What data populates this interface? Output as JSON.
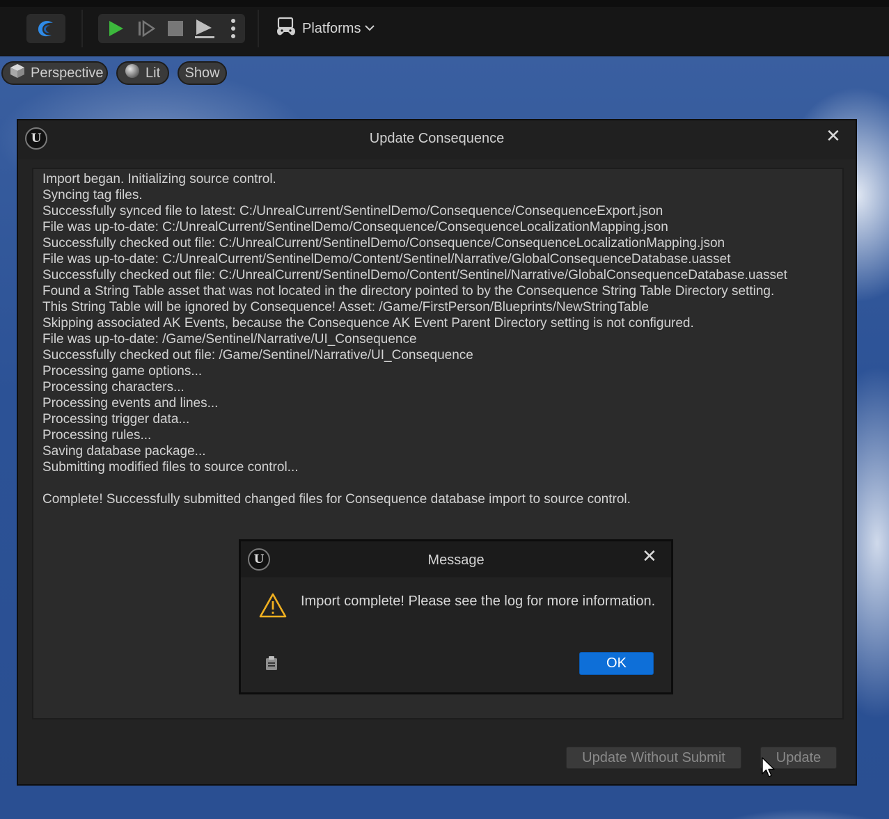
{
  "toolbar": {
    "platforms_label": "Platforms",
    "icons": [
      "ue-swirl-icon",
      "play-icon",
      "step-icon",
      "stop-icon",
      "eject-icon",
      "more-vertical-icon",
      "gamepad-icon",
      "chevron-down-icon"
    ],
    "play_color": "#3cb83c"
  },
  "viewport": {
    "perspective_label": "Perspective",
    "lit_label": "Lit",
    "show_label": "Show"
  },
  "dialog": {
    "title": "Update Consequence",
    "log_lines": [
      "Import began. Initializing source control.",
      "Syncing tag files.",
      "Successfully synced file to latest: C:/UnrealCurrent/SentinelDemo/Consequence/ConsequenceExport.json",
      "File was up-to-date: C:/UnrealCurrent/SentinelDemo/Consequence/ConsequenceLocalizationMapping.json",
      "Successfully checked out file: C:/UnrealCurrent/SentinelDemo/Consequence/ConsequenceLocalizationMapping.json",
      "File was up-to-date: C:/UnrealCurrent/SentinelDemo/Content/Sentinel/Narrative/GlobalConsequenceDatabase.uasset",
      "Successfully checked out file: C:/UnrealCurrent/SentinelDemo/Content/Sentinel/Narrative/GlobalConsequenceDatabase.uasset",
      "Found a String Table asset that was not located in the directory pointed to by the Consequence String Table Directory setting.",
      "This String Table will be ignored by Consequence! Asset: /Game/FirstPerson/Blueprints/NewStringTable",
      "Skipping associated AK Events, because the Consequence AK Event Parent Directory setting is not configured.",
      "File was up-to-date: /Game/Sentinel/Narrative/UI_Consequence",
      "Successfully checked out file: /Game/Sentinel/Narrative/UI_Consequence",
      "Processing game options...",
      "Processing characters...",
      "Processing events and lines...",
      "Processing trigger data...",
      "Processing rules...",
      "Saving database package...",
      "Submitting modified files to source control...",
      "",
      "Complete! Successfully submitted changed files for Consequence database import to source control."
    ],
    "update_without_submit_label": "Update Without Submit",
    "update_label": "Update"
  },
  "message": {
    "title": "Message",
    "text": "Import complete! Please see the log for more information.",
    "ok_label": "OK",
    "warning_color": "#f0b020",
    "accent_color": "#0e6fd8"
  }
}
